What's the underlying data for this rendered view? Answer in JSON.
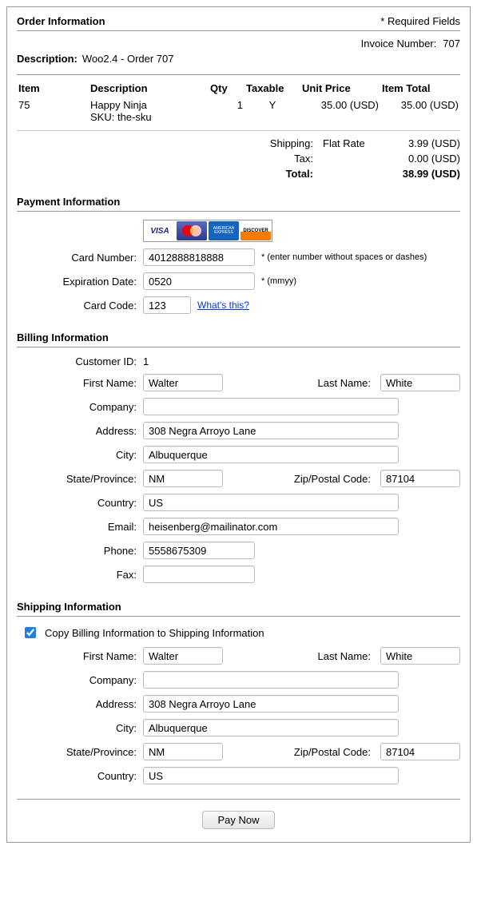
{
  "header": {
    "order_info_title": "Order Information",
    "required_fields": "* Required Fields",
    "invoice_label": "Invoice Number:",
    "invoice_number": "707",
    "description_label": "Description:",
    "description_value": "Woo2.4 - Order 707"
  },
  "items_table": {
    "cols": {
      "item": "Item",
      "desc": "Description",
      "qty": "Qty",
      "tax": "Taxable",
      "unit": "Unit Price",
      "total": "Item Total"
    },
    "rows": [
      {
        "item": "75",
        "desc": "Happy Ninja",
        "sku": "SKU: the-sku",
        "qty": "1",
        "tax": "Y",
        "unit": "35.00 (USD)",
        "total": "35.00 (USD)"
      }
    ]
  },
  "totals": {
    "shipping_label": "Shipping:",
    "shipping_method": "Flat Rate",
    "shipping_amount": "3.99 (USD)",
    "tax_label": "Tax:",
    "tax_amount": "0.00 (USD)",
    "total_label": "Total:",
    "total_amount": "38.99 (USD)"
  },
  "payment": {
    "title": "Payment Information",
    "card_number_label": "Card Number:",
    "card_number": "4012888818888",
    "card_number_hint": "* (enter number without spaces or dashes)",
    "exp_label": "Expiration Date:",
    "exp": "0520",
    "exp_hint": "* (mmyy)",
    "code_label": "Card Code:",
    "code": "123",
    "whats_this": "What's this?"
  },
  "billing": {
    "title": "Billing Information",
    "customer_id_label": "Customer ID:",
    "customer_id": "1",
    "first_name_label": "First Name:",
    "first_name": "Walter",
    "last_name_label": "Last Name:",
    "last_name": "White",
    "company_label": "Company:",
    "company": "",
    "address_label": "Address:",
    "address": "308 Negra Arroyo Lane",
    "city_label": "City:",
    "city": "Albuquerque",
    "state_label": "State/Province:",
    "state": "NM",
    "zip_label": "Zip/Postal Code:",
    "zip": "87104",
    "country_label": "Country:",
    "country": "US",
    "email_label": "Email:",
    "email": "heisenberg@mailinator.com",
    "phone_label": "Phone:",
    "phone": "5558675309",
    "fax_label": "Fax:",
    "fax": ""
  },
  "shipping": {
    "title": "Shipping Information",
    "copy_label": "Copy Billing Information to Shipping Information",
    "first_name_label": "First Name:",
    "first_name": "Walter",
    "last_name_label": "Last Name:",
    "last_name": "White",
    "company_label": "Company:",
    "company": "",
    "address_label": "Address:",
    "address": "308 Negra Arroyo Lane",
    "city_label": "City:",
    "city": "Albuquerque",
    "state_label": "State/Province:",
    "state": "NM",
    "zip_label": "Zip/Postal Code:",
    "zip": "87104",
    "country_label": "Country:",
    "country": "US"
  },
  "actions": {
    "pay_now": "Pay Now"
  }
}
